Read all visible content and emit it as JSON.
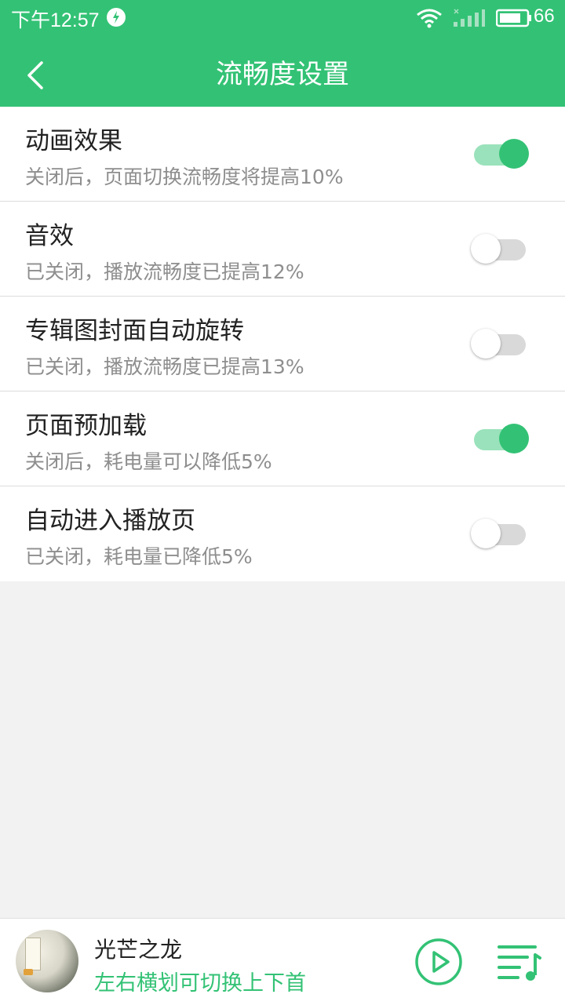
{
  "status_bar": {
    "time": "下午12:57",
    "battery": "66"
  },
  "header": {
    "title": "流畅度设置"
  },
  "settings": [
    {
      "title": "动画效果",
      "subtitle": "关闭后，页面切换流畅度将提高10%",
      "enabled": true
    },
    {
      "title": "音效",
      "subtitle": "已关闭，播放流畅度已提高12%",
      "enabled": false
    },
    {
      "title": "专辑图封面自动旋转",
      "subtitle": "已关闭，播放流畅度已提高13%",
      "enabled": false
    },
    {
      "title": "页面预加载",
      "subtitle": "关闭后，耗电量可以降低5%",
      "enabled": true
    },
    {
      "title": "自动进入播放页",
      "subtitle": "已关闭，耗电量已降低5%",
      "enabled": false
    }
  ],
  "player": {
    "song_title": "光芒之龙",
    "hint": "左右横划可切换上下首"
  },
  "colors": {
    "accent": "#33c275",
    "toggle_track_on": "#9ae2bb",
    "toggle_track_off": "#d9d9d9",
    "background": "#f2f2f2"
  },
  "icons": {
    "back": "back-arrow-icon",
    "play": "play-circle-icon",
    "playlist": "playlist-music-icon",
    "wifi": "wifi-icon",
    "signal": "signal-icon",
    "battery": "battery-icon",
    "app": "app-notification-icon"
  }
}
